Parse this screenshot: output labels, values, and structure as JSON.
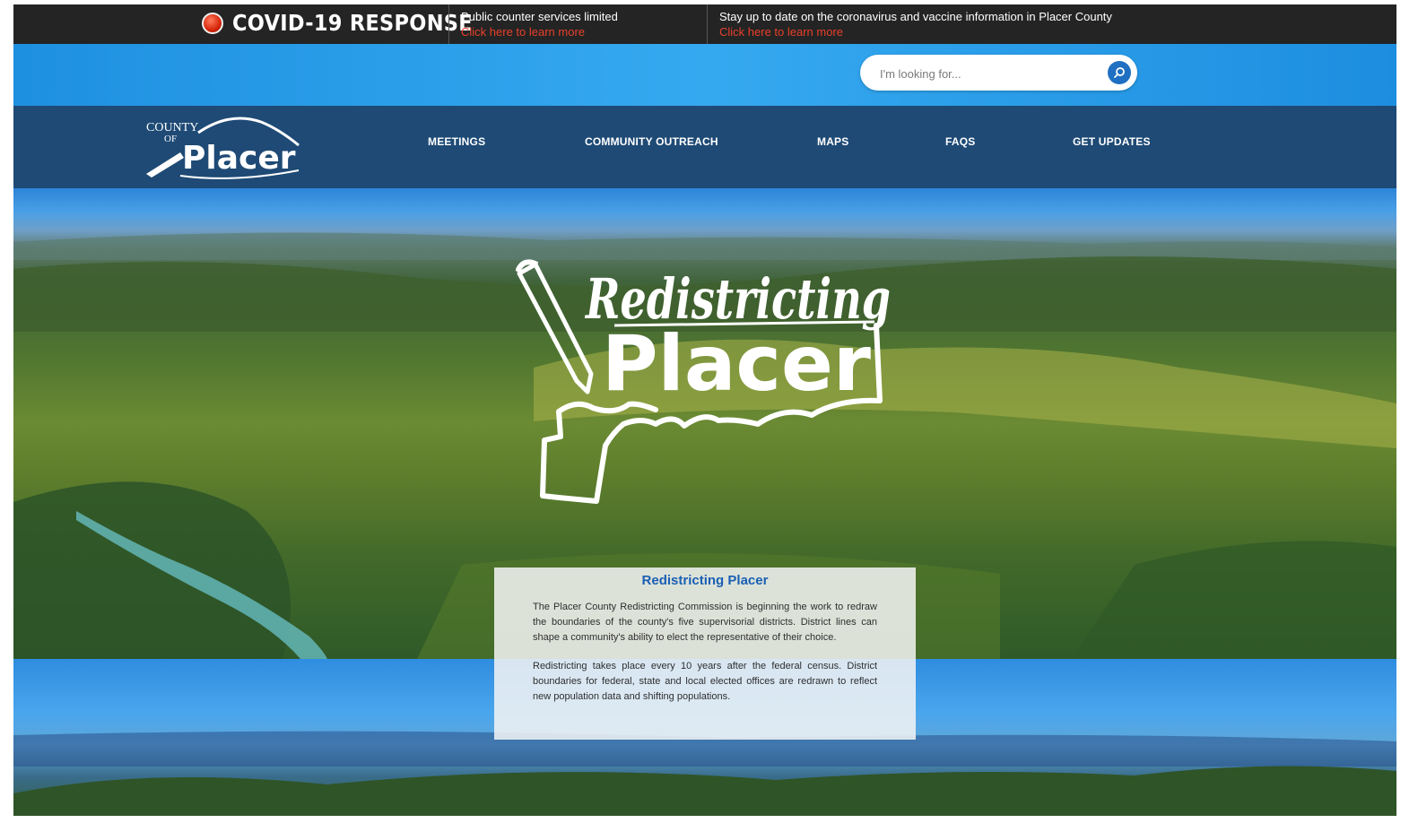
{
  "covid_bar": {
    "title": "COVID-19 RESPONSE",
    "notice1": {
      "message": "Public counter services limited",
      "link": "Click here to learn more"
    },
    "notice2": {
      "message": "Stay up to date on the coronavirus and vaccine information in Placer County",
      "link": "Click here to learn more"
    }
  },
  "search": {
    "placeholder": "I'm looking for..."
  },
  "logo": {
    "line1": "COUNTY",
    "line2": "OF",
    "name": "Placer"
  },
  "nav": {
    "items": [
      "MEETINGS",
      "COMMUNITY OUTREACH",
      "MAPS",
      "FAQS",
      "GET UPDATES"
    ]
  },
  "hero": {
    "script_text": "Redistricting",
    "block_text": "Placer"
  },
  "card": {
    "title": "Redistricting Placer",
    "paragraph1": "The Placer County Redistricting Commission is beginning the work to redraw the boundaries of the county's five supervisorial districts. District lines can shape a community's ability to elect the representative of their choice.",
    "paragraph2": "Redistricting takes place every 10 years after the federal census. District boundaries for federal, state and local elected offices are redrawn to reflect new population data and shifting populations."
  },
  "colors": {
    "covid_bar": "#242424",
    "alert_link": "#e8402a",
    "search_band": "#2a9be8",
    "nav": "#1e4a75",
    "card_title": "#1a5fb4"
  },
  "icons": {
    "covid": "record-dot-icon",
    "search": "search-icon",
    "pencil": "pencil-icon"
  }
}
